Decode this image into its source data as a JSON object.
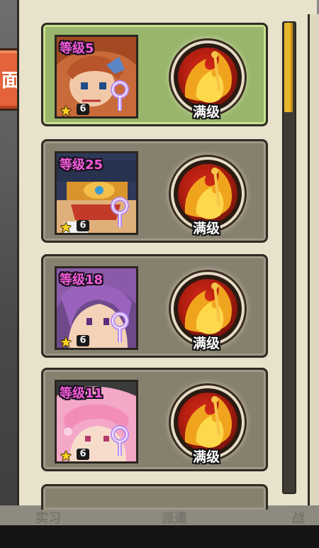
{
  "side_button": {
    "label": "面"
  },
  "background_tabs": [
    "实习",
    "派遣",
    "战"
  ],
  "colors": {
    "selected_card": "#98b56b",
    "card": "#87806f",
    "level_text": "#f35bd9",
    "scroll_thumb": "#e7b62c"
  },
  "scrollbar": {
    "position_fraction": 0.0
  },
  "cards": [
    {
      "level": "等级5",
      "stars": "6",
      "skill_status": "满级",
      "selected": true,
      "icons": {
        "star": "star-icon",
        "weapon": "staff-icon",
        "skill": "flame-skill-icon"
      }
    },
    {
      "level": "等级25",
      "stars": "6",
      "skill_status": "满级",
      "selected": false,
      "icons": {
        "star": "star-icon",
        "weapon": "staff-icon",
        "skill": "flame-skill-icon"
      }
    },
    {
      "level": "等级18",
      "stars": "6",
      "skill_status": "满级",
      "selected": false,
      "icons": {
        "star": "star-icon",
        "weapon": "staff-icon",
        "skill": "flame-skill-icon"
      }
    },
    {
      "level": "等级11",
      "stars": "6",
      "skill_status": "满级",
      "selected": false,
      "icons": {
        "star": "star-icon",
        "weapon": "staff-icon",
        "skill": "flame-skill-icon"
      }
    }
  ]
}
